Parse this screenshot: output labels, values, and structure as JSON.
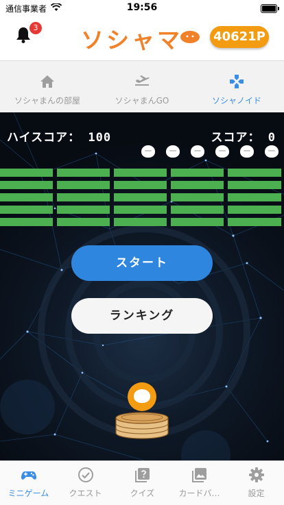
{
  "status_bar": {
    "carrier": "通信事業者",
    "time": "19:56"
  },
  "header": {
    "logo_text": "ソシャマ",
    "notification_count": "3",
    "points": "40621P",
    "brand_color": "#f0822a"
  },
  "top_tabs": [
    {
      "label": "ソシャまんの部屋",
      "icon": "home-icon",
      "active": false
    },
    {
      "label": "ソシャまんGO",
      "icon": "airplane-icon",
      "active": false
    },
    {
      "label": "ソシャノイド",
      "icon": "gamepad-icon",
      "active": true
    }
  ],
  "game": {
    "high_score_label": "ハイスコア： 100",
    "score_label": "スコア： 0",
    "lives": 6,
    "brick_rows": 5,
    "brick_cols": 5,
    "brick_color": "#4caf50",
    "start_label": "スタート",
    "ranking_label": "ランキング"
  },
  "bottom_nav": [
    {
      "label": "ミニゲーム",
      "icon": "gamepad-icon",
      "active": true
    },
    {
      "label": "クエスト",
      "icon": "check-circle-icon",
      "active": false
    },
    {
      "label": "クイズ",
      "icon": "question-icon",
      "active": false
    },
    {
      "label": "カードバ…",
      "icon": "image-icon",
      "active": false
    },
    {
      "label": "設定",
      "icon": "gear-icon",
      "active": false
    }
  ]
}
